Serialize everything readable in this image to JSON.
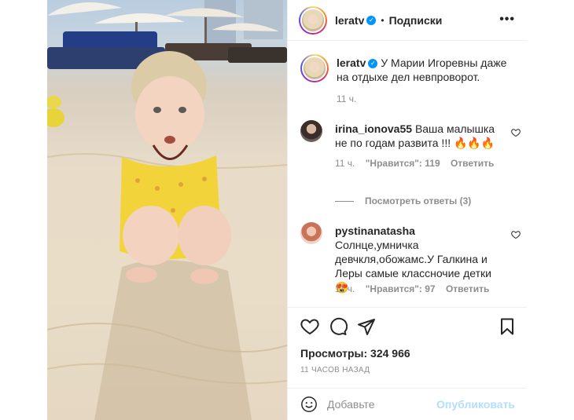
{
  "header": {
    "username": "leratv",
    "separator": "•",
    "follow_label": "Подписки",
    "more_label": "•••"
  },
  "caption": {
    "username": "leratv",
    "text": "У Марии Игоревны даже на отдыхе дел невпроворот.",
    "time": "11 ч."
  },
  "comments": [
    {
      "username": "irina_ionova55",
      "text": "Ваша малышка не по годам развита !!! 🔥🔥🔥",
      "time": "11 ч.",
      "likes": "\"Нравится\": 119",
      "reply": "Ответить"
    },
    {
      "username": "pystinanatasha",
      "text": "Солнце,умничка девчкля,обожамс.У Галкина и Леры самые классночие детки 😍",
      "time": "11 ч.",
      "likes": "\"Нравится\": 97",
      "reply": "Ответить"
    }
  ],
  "view_replies": "Посмотреть ответы (3)",
  "actions": {
    "views": "Просмотры: 324 966",
    "when": "11 ЧАСОВ НАЗАД"
  },
  "add_comment": {
    "placeholder": "Добавьте",
    "publish": "Опубликовать"
  },
  "colors": {
    "accent": "#0095f6",
    "publish_disabled": "#b2dffc",
    "muted": "#8e8e8e"
  }
}
